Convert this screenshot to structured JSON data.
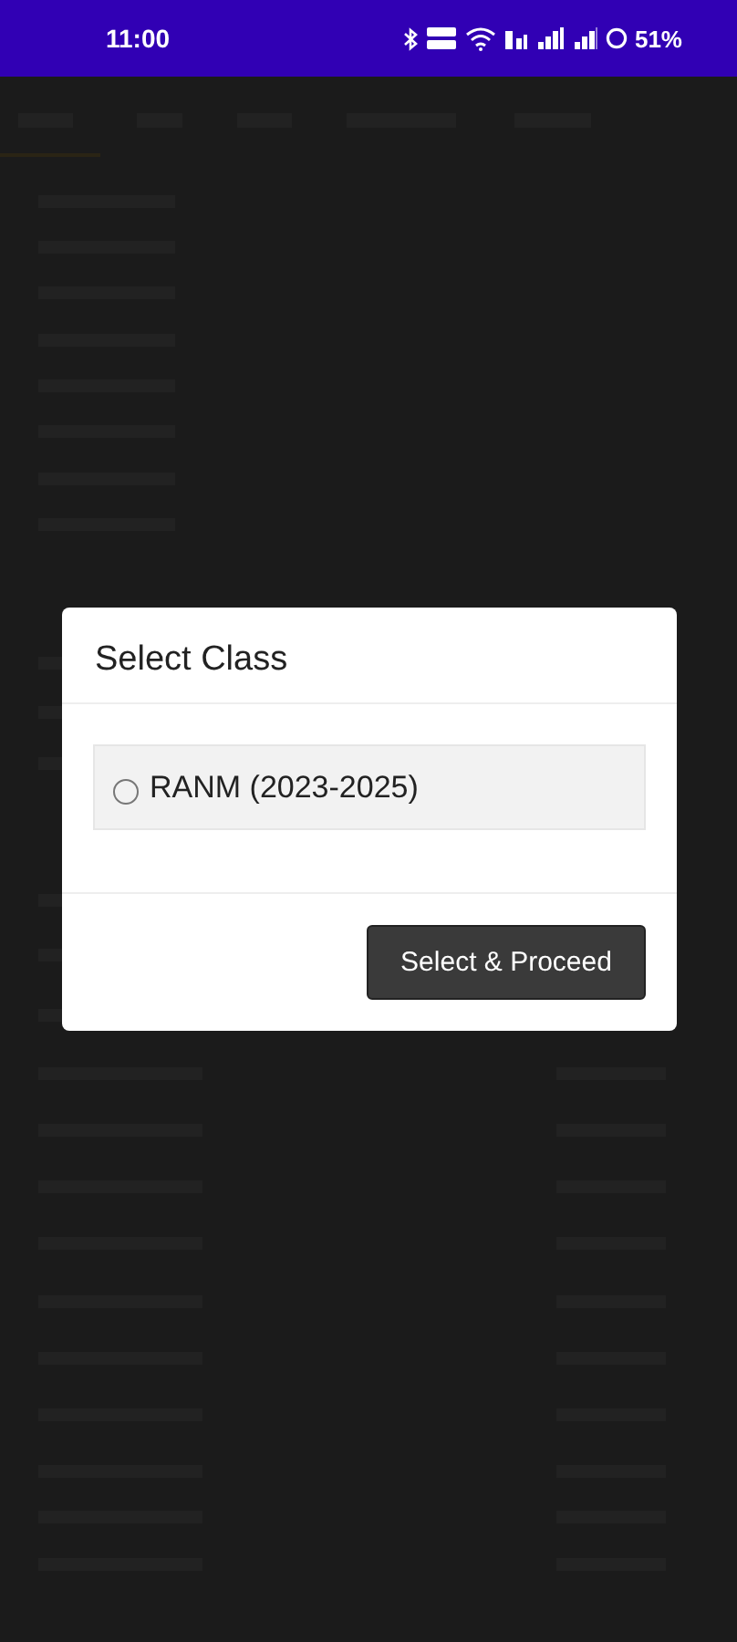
{
  "status_bar": {
    "time": "11:00",
    "battery": "51%"
  },
  "dialog": {
    "title": "Select Class",
    "options": [
      {
        "label": "RANM (2023-2025)",
        "selected": false
      }
    ],
    "button": "Select & Proceed"
  }
}
